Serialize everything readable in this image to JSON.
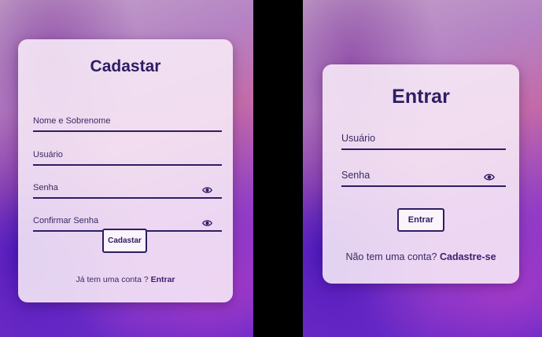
{
  "signup": {
    "title": "Cadastar",
    "fields": [
      {
        "label": "Nome e Sobrenome"
      },
      {
        "label": "Usuário"
      },
      {
        "label": "Senha"
      },
      {
        "label": "Confirmar Senha"
      }
    ],
    "button_label": "Cadastar",
    "footer_text": "Já tem uma conta ?",
    "footer_link": "Entrar"
  },
  "login": {
    "title": "Entrar",
    "fields": [
      {
        "label": "Usuário"
      },
      {
        "label": "Senha"
      }
    ],
    "button_label": "Entrar",
    "footer_text": "Não tem uma conta?",
    "footer_link": "Cadastre-se"
  },
  "colors": {
    "accent": "#2e1d63",
    "card_bg": "#f8ecf8"
  },
  "icons": {
    "password_toggle": "eye-icon"
  }
}
